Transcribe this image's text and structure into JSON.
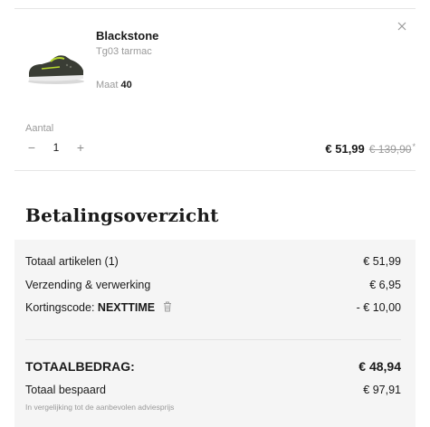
{
  "product": {
    "name": "Blackstone",
    "variant": "Tg03 tarmac",
    "size_label": "Maat",
    "size_value": "40",
    "close_icon": "close-icon"
  },
  "quantity": {
    "label": "Aantal",
    "decrement": "−",
    "value": "1",
    "increment": "+"
  },
  "price": {
    "current": "€ 51,99",
    "original": "€ 139,90",
    "marker": "*"
  },
  "summary": {
    "title": "Betalingsoverzicht",
    "rows": [
      {
        "label": "Totaal artikelen (1)",
        "value": "€ 51,99"
      },
      {
        "label": "Verzending & verwerking",
        "value": "€ 6,95"
      }
    ],
    "coupon": {
      "label": "Kortingscode:",
      "code": "NEXTTIME",
      "value": "- € 10,00",
      "icon": "trash-icon"
    },
    "total": {
      "label": "TOTAALBEDRAG:",
      "value": "€ 48,94"
    },
    "saved": {
      "label": "Totaal bespaard",
      "value": "€ 97,91"
    },
    "note": "In vergelijking tot de aanbevolen adviesprijs"
  },
  "colors": {
    "text": "#1a1a1a",
    "muted": "#9a9a9a",
    "panel": "#f5f5f5",
    "divider": "#e6e6e6",
    "shoe_accent": "#b7d92f"
  }
}
